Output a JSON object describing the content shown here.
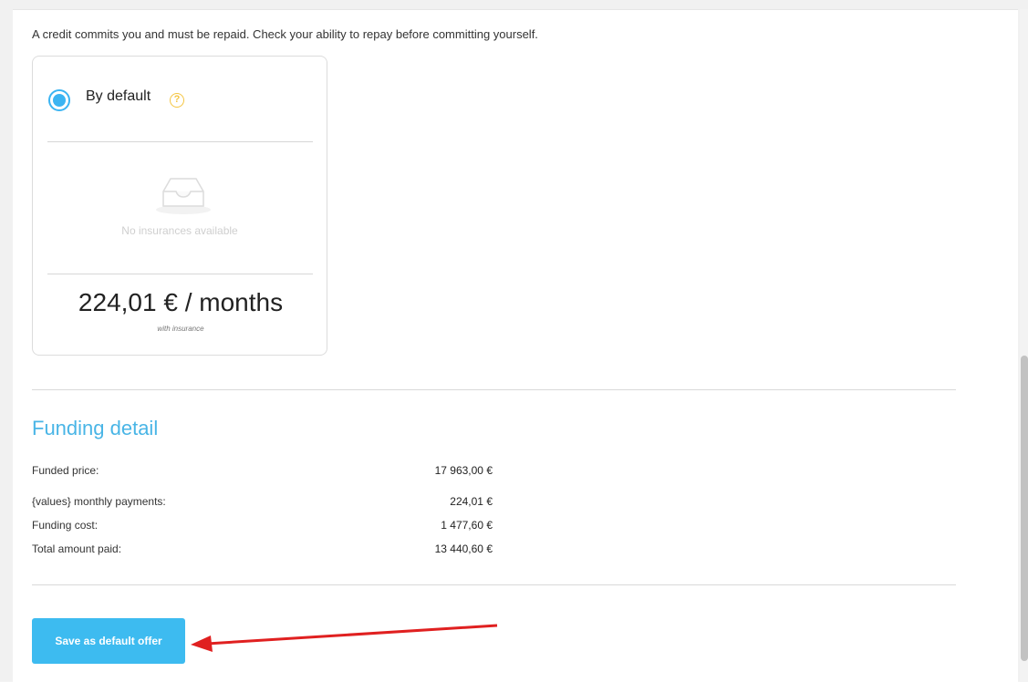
{
  "disclaimer": "A credit commits you and must be repaid. Check your ability to repay before committing yourself.",
  "offer": {
    "title": "By default",
    "selected": true,
    "help_icon": "question-circle-icon",
    "empty_icon": "inbox-tray-icon",
    "empty_text": "No insurances available",
    "price": "224,01 € / months",
    "price_note": "with insurance"
  },
  "funding_detail": {
    "title": "Funding detail",
    "rows": [
      {
        "label": "Funded price:",
        "value": "17 963,00 €"
      },
      {
        "label": "{values} monthly payments:",
        "value": "224,01 €"
      },
      {
        "label": "Funding cost:",
        "value": "1 477,60 €"
      },
      {
        "label": "Total amount paid:",
        "value": "13 440,60 €"
      }
    ]
  },
  "actions": {
    "save_label": "Save as default offer"
  },
  "colors": {
    "accent": "#3dbbf0",
    "title_blue": "#49b5e6",
    "annotation_arrow": "#e02020",
    "help_icon": "#f4c542"
  }
}
